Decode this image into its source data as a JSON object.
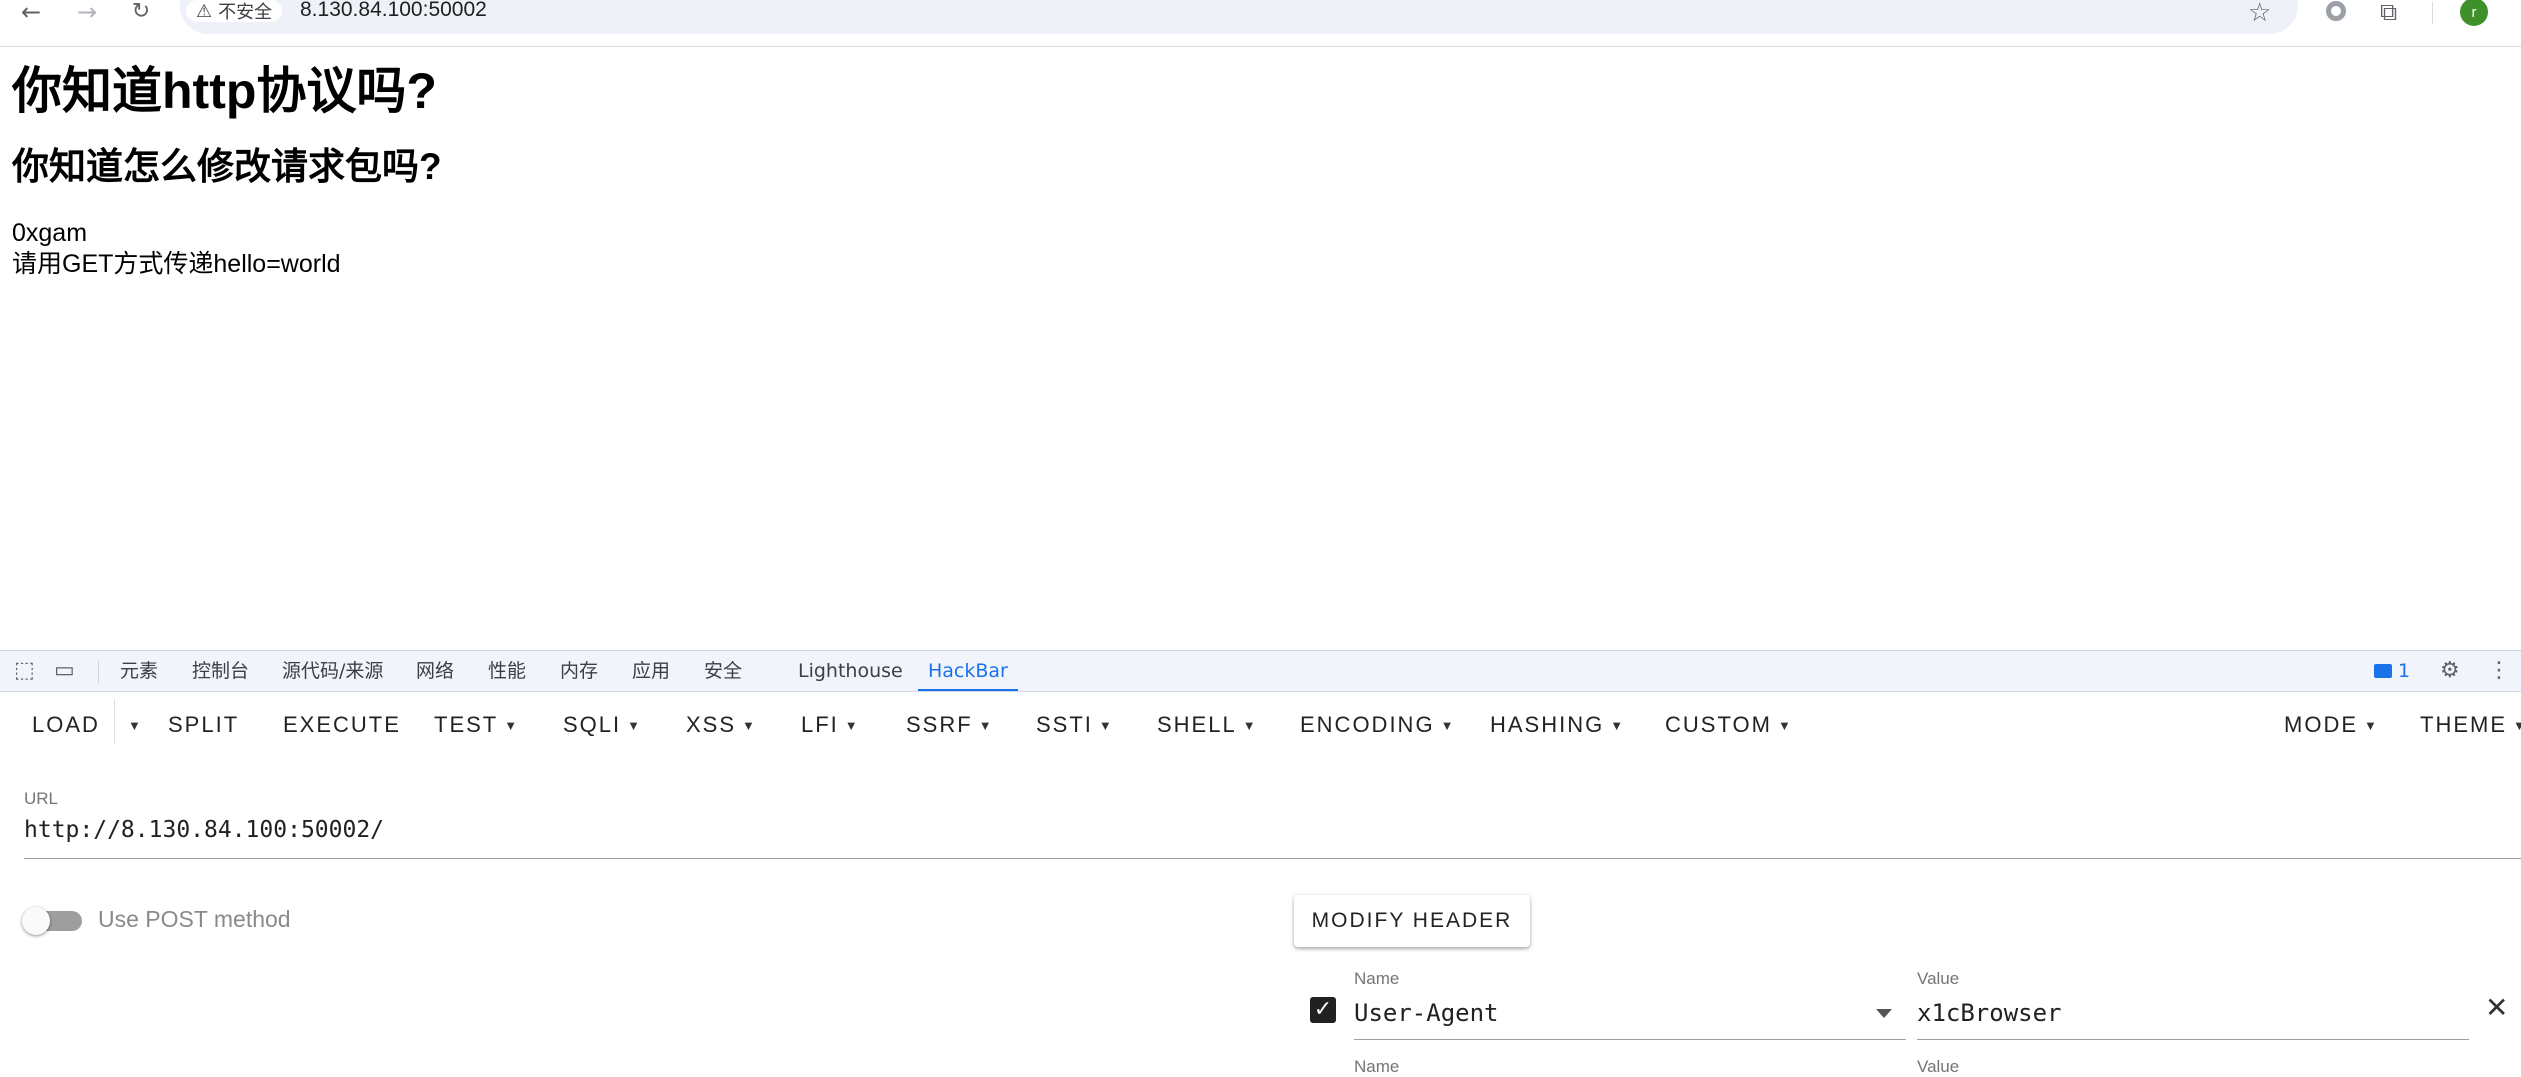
{
  "browser": {
    "security_label": "不安全",
    "address": "8.130.84.100:50002",
    "avatar_letter": "r"
  },
  "page": {
    "heading1": "你知道http协议吗?",
    "heading2": "你知道怎么修改请求包吗?",
    "line1": "0xgam",
    "line2": "请用GET方式传递hello=world"
  },
  "devtools": {
    "tabs": [
      "元素",
      "控制台",
      "源代码/来源",
      "网络",
      "性能",
      "内存",
      "应用",
      "安全",
      "Lighthouse",
      "HackBar"
    ],
    "active_tab": "HackBar",
    "issues_count": "1"
  },
  "hackbar": {
    "menu": {
      "load": "LOAD",
      "split": "SPLIT",
      "execute": "EXECUTE",
      "test": "TEST",
      "sqli": "SQLI",
      "xss": "XSS",
      "lfi": "LFI",
      "ssrf": "SSRF",
      "ssti": "SSTI",
      "shell": "SHELL",
      "encoding": "ENCODING",
      "hashing": "HASHING",
      "custom": "CUSTOM",
      "mode": "MODE",
      "theme": "THEME"
    },
    "url_label": "URL",
    "url_value": "http://8.130.84.100:50002/",
    "post_toggle_label": "Use POST method",
    "post_enabled": false,
    "modify_header_label": "MODIFY HEADER",
    "headers": [
      {
        "enabled": true,
        "name_label": "Name",
        "name": "User-Agent",
        "value_label": "Value",
        "value": "x1cBrowser"
      },
      {
        "name_label": "Name",
        "value_label": "Value"
      }
    ]
  }
}
